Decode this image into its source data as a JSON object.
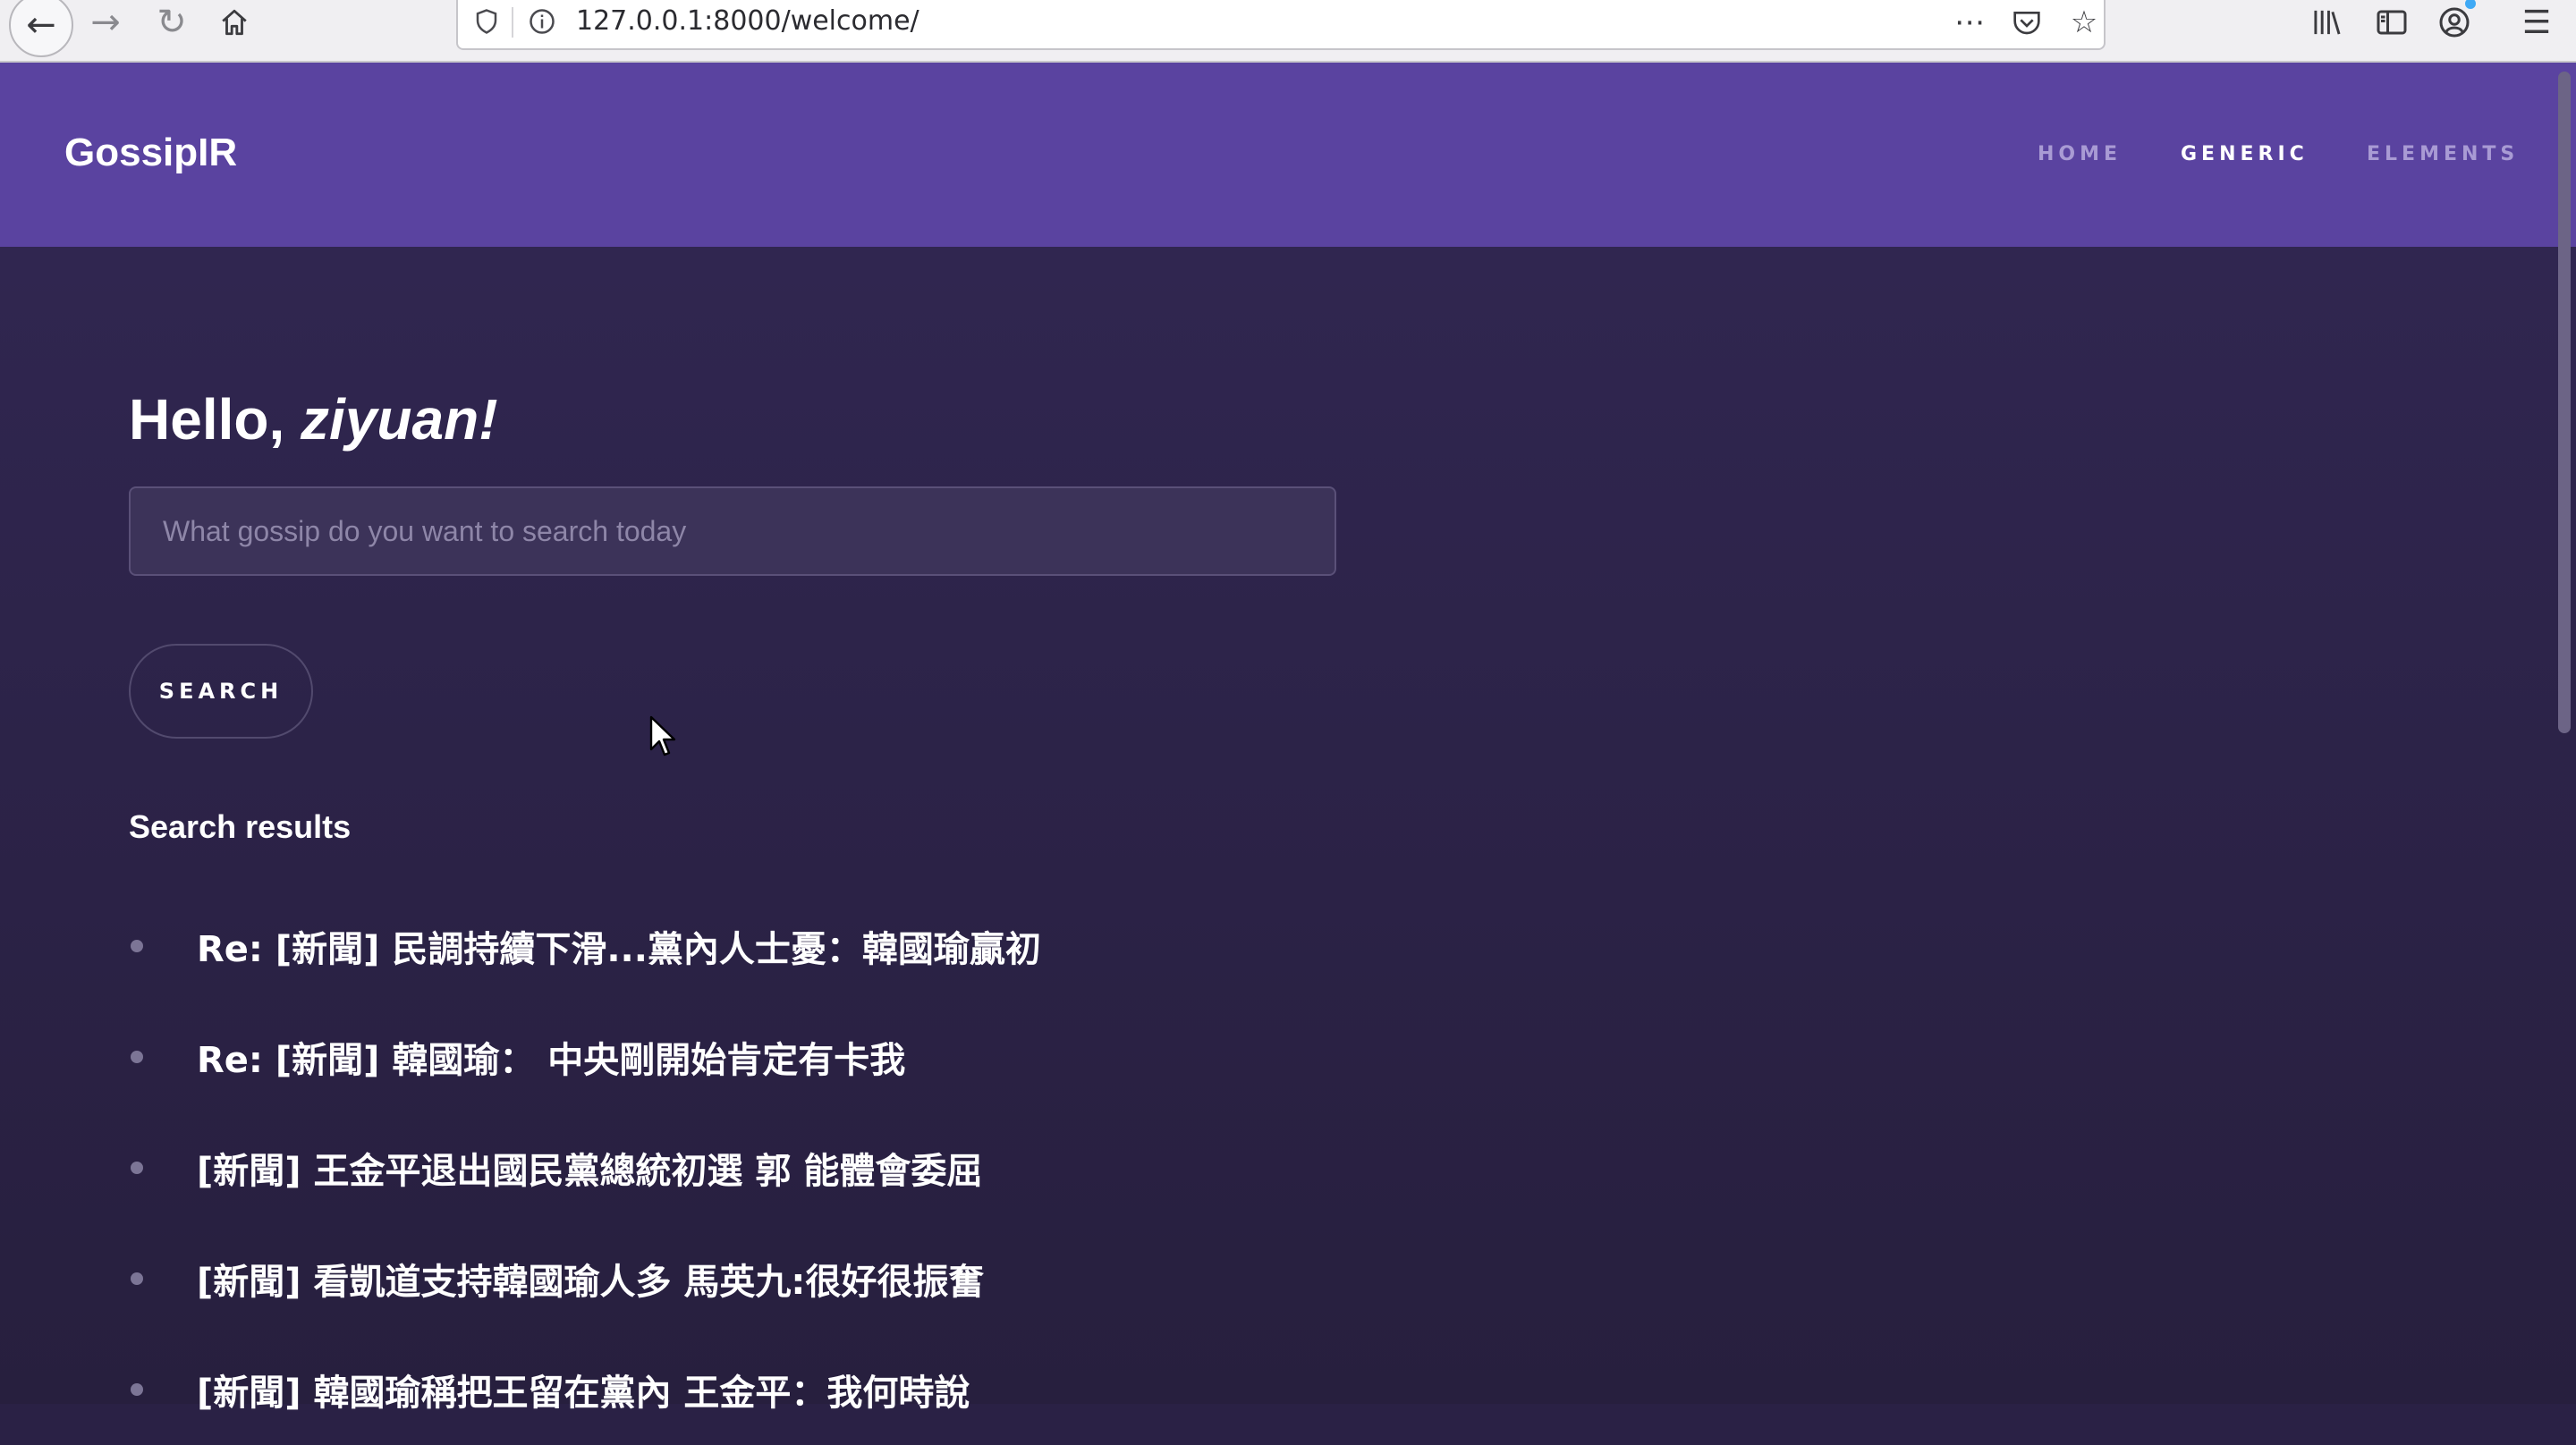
{
  "browser": {
    "url": "127.0.0.1:8000/welcome/",
    "icons": {
      "back": "back-arrow-icon",
      "forward": "forward-arrow-icon",
      "reload": "reload-icon",
      "home": "home-icon",
      "shield": "shield-icon",
      "info": "info-icon",
      "more": "more-dots-icon",
      "pocket": "pocket-icon",
      "bookmark": "star-icon",
      "library": "library-icon",
      "sidebar": "sidebar-icon",
      "account": "account-icon",
      "menu": "hamburger-menu-icon"
    }
  },
  "header": {
    "logo": "GossipIR",
    "nav": [
      {
        "label": "HOME",
        "active": false
      },
      {
        "label": "GENERIC",
        "active": true
      },
      {
        "label": "ELEMENTS",
        "active": false
      }
    ]
  },
  "main": {
    "greeting_prefix": "Hello,",
    "username": "ziyuan!",
    "search": {
      "placeholder": "What gossip do you want to search today",
      "value": "",
      "button_label": "SEARCH"
    },
    "results_heading": "Search results",
    "results": [
      "Re: [新聞] 民調持續下滑...黨內人士憂：韓國瑜贏初",
      "Re: [新聞] 韓國瑜： 中央剛開始肯定有卡我",
      "[新聞] 王金平退出國民黨總統初選 郭 能體會委屈",
      "[新聞] 看凱道支持韓國瑜人多 馬英九:很好很振奮",
      "[新聞] 韓國瑜稱把王留在黨內 王金平：我何時說"
    ]
  },
  "colors": {
    "header_bg": "#5a43a0",
    "page_bg": "#2a2145",
    "nav_inactive": "#a99bd4",
    "nav_active": "#ffffff"
  }
}
